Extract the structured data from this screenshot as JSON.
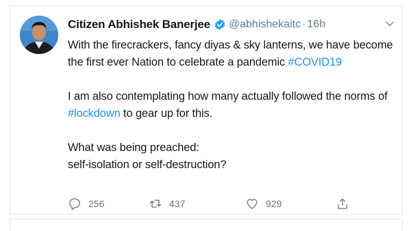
{
  "tweet": {
    "display_name": "Citizen Abhishek Banerjee",
    "handle": "@abhishekaitc",
    "separator": "·",
    "time": "16h",
    "avatar_icon": "profile-photo",
    "verified_icon": "verified-badge-icon",
    "caret_icon": "chevron-down-icon",
    "body": {
      "p1_text": "With the firecrackers, fancy diyas & sky lanterns, we have become the first ever Nation to celebrate a pandemic ",
      "p1_hashtag": "#COVID19",
      "p2_text_before": "I am also contemplating how many actually followed the norms of ",
      "p2_hashtag": "#lockdown",
      "p2_text_after": " to gear up for this.",
      "p3_line1": "What was being preached:",
      "p3_line2": "self-isolation or self-destruction?"
    },
    "actions": {
      "replies": "256",
      "retweets": "437",
      "likes": "929"
    }
  },
  "colors": {
    "link": "#1b95e0",
    "verified": "#1da1f2",
    "muted": "#657786",
    "border": "#e1e8ed"
  }
}
